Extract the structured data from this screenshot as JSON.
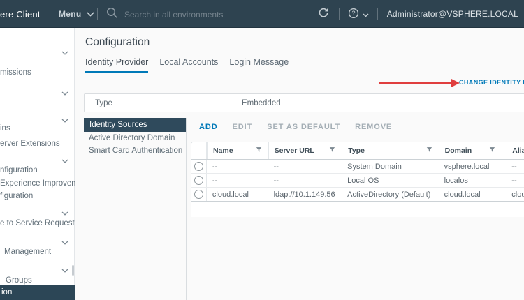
{
  "topbar": {
    "brand": "ere Client",
    "menu_label": "Menu",
    "search_placeholder": "Search in all environments",
    "user": "Administrator@VSPHERE.LOCAL"
  },
  "sidebar": {
    "rows": [
      {
        "kind": "cat",
        "label": ""
      },
      {
        "kind": "item",
        "label": "missions"
      },
      {
        "kind": "cat",
        "label": ""
      },
      {
        "kind": "cat",
        "label": ""
      },
      {
        "kind": "item",
        "label": "ins"
      },
      {
        "kind": "item",
        "label": "erver Extensions"
      },
      {
        "kind": "cat",
        "label": ""
      },
      {
        "kind": "item",
        "label": "nfiguration"
      },
      {
        "kind": "item",
        "label": "Experience Improvem..."
      },
      {
        "kind": "item",
        "label": "figuration"
      },
      {
        "kind": "cat",
        "label": ""
      },
      {
        "kind": "item",
        "label": "e to Service Request"
      },
      {
        "kind": "cat",
        "label": ""
      },
      {
        "kind": "item",
        "label": "Management"
      },
      {
        "kind": "cat",
        "label": ""
      },
      {
        "kind": "item",
        "label": "Groups"
      },
      {
        "kind": "item",
        "label": "ion",
        "selected": true
      }
    ]
  },
  "main": {
    "title": "Configuration",
    "tabs": [
      {
        "label": "Identity Provider",
        "active": true
      },
      {
        "label": "Local Accounts",
        "active": false
      },
      {
        "label": "Login Message",
        "active": false
      }
    ],
    "change_link": "CHANGE IDENTITY PROVIDER",
    "type_row": {
      "label": "Type",
      "value": "Embedded"
    },
    "section_nav": [
      {
        "label": "Identity Sources",
        "selected": true
      },
      {
        "label": "Active Directory Domain",
        "selected": false
      },
      {
        "label": "Smart Card Authentication",
        "selected": false
      }
    ],
    "toolbar": [
      {
        "label": "ADD",
        "enabled": true
      },
      {
        "label": "EDIT",
        "enabled": false
      },
      {
        "label": "SET AS DEFAULT",
        "enabled": false
      },
      {
        "label": "REMOVE",
        "enabled": false
      }
    ],
    "table": {
      "columns": [
        {
          "label": "Name",
          "filter": true
        },
        {
          "label": "Server URL",
          "filter": true
        },
        {
          "label": "Type",
          "filter": true
        },
        {
          "label": "Domain",
          "filter": true
        },
        {
          "label": "Alias",
          "filter": false
        }
      ],
      "rows": [
        [
          "--",
          "--",
          "System Domain",
          "vsphere.local",
          "--"
        ],
        [
          "--",
          "--",
          "Local OS",
          "localos",
          "--"
        ],
        [
          "cloud.local",
          "ldap://10.1.149.56",
          "ActiveDirectory (Default)",
          "cloud.local",
          "cloud.local"
        ]
      ]
    }
  },
  "colors": {
    "topbar_bg": "#2e4350",
    "selected_nav_bg": "#2f4a5c",
    "accent_blue": "#0079b8",
    "annotation_red": "#e03e3e"
  }
}
